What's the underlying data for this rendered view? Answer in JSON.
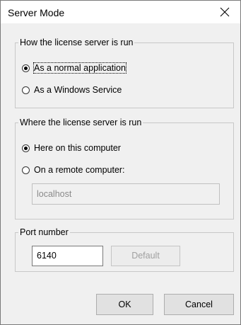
{
  "window": {
    "title": "Server Mode",
    "close_icon": "close-icon"
  },
  "run_group": {
    "legend": "How the license server is run",
    "options": [
      {
        "label": "As a normal application",
        "checked": true
      },
      {
        "label": "As a Windows Service",
        "checked": false
      }
    ]
  },
  "where_group": {
    "legend": "Where the license server is run",
    "options": [
      {
        "label": "Here on this computer",
        "checked": true
      },
      {
        "label": "On a remote computer:",
        "checked": false
      }
    ],
    "remote_host": "localhost"
  },
  "port_group": {
    "legend": "Port number",
    "port_value": "6140",
    "default_label": "Default"
  },
  "footer": {
    "ok_label": "OK",
    "cancel_label": "Cancel"
  }
}
